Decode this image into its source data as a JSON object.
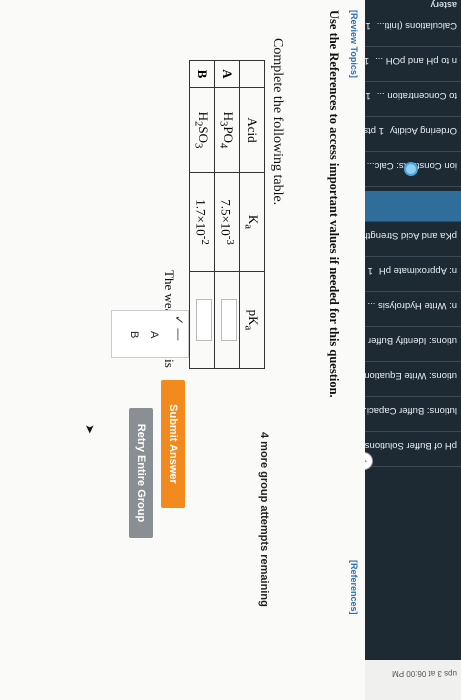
{
  "sidebar": {
    "title": "astery",
    "items": [
      {
        "label": "Calculations (Initi...",
        "points": "1 pts",
        "attempts": "2req"
      },
      {
        "label": "n to pH and pOH ...",
        "points": "1 pts",
        "attempts": "2req"
      },
      {
        "label": "to Concentration ...",
        "points": "1 pts",
        "attempts": "2req"
      },
      {
        "label": "Ordering Acidity",
        "points": "1 pts",
        "attempts": "",
        "badge": "10"
      },
      {
        "label": "ion Constants: Calc...",
        "points": "1 pts",
        "attempts": "2req"
      },
      {
        "label": "",
        "points": "",
        "attempts": ""
      },
      {
        "label": "pKa and Acid Strength",
        "points": "1 pts",
        "attempts": "",
        "badge": "10"
      },
      {
        "label": "n: Approximate pH",
        "points": "1 pts",
        "attempts": "2req"
      },
      {
        "label": "n: Write Hydrolysis ...",
        "points": "1 pts",
        "attempts": "2req"
      },
      {
        "label": "utions: Identify Buffer",
        "points": "1 pts",
        "attempts": "2req"
      },
      {
        "label": "utions: Write Equation...",
        "points": "1 pts",
        "attempts": "2req"
      },
      {
        "label": "lutions: Buffer Capaci...",
        "points": "1 pts",
        "attempts": "2req"
      },
      {
        "label": "pH of Buffer Solutions",
        "points": "1 pts",
        "attempts": "2req"
      }
    ],
    "footer": "ups\n3 at 06:00 PM"
  },
  "header": {
    "review_topics": "[Review Topics]",
    "references": "[References]"
  },
  "instructions": "Use the References to access important values if needed for this question.",
  "table_heading": "Complete the following table.",
  "table": {
    "columns": [
      "",
      "Acid",
      "Ka",
      "pKa"
    ],
    "rows": [
      {
        "label": "A",
        "acid": "H3PO4",
        "ka": "7.5×10-3"
      },
      {
        "label": "B",
        "acid": "H2SO3",
        "ka": "1.7×10-2"
      }
    ]
  },
  "question": "The weaker acid is",
  "select": {
    "current": "✓ —",
    "options": [
      "A",
      "B"
    ]
  },
  "buttons": {
    "submit": "Submit Answer",
    "retry": "Retry Entire Group"
  },
  "remaining": "4 more group attempts remaining",
  "colors": {
    "sidebar_bg": "#1e2a33",
    "submit": "#f28a1e",
    "retry": "#8a8f94",
    "link": "#2a6db0"
  }
}
